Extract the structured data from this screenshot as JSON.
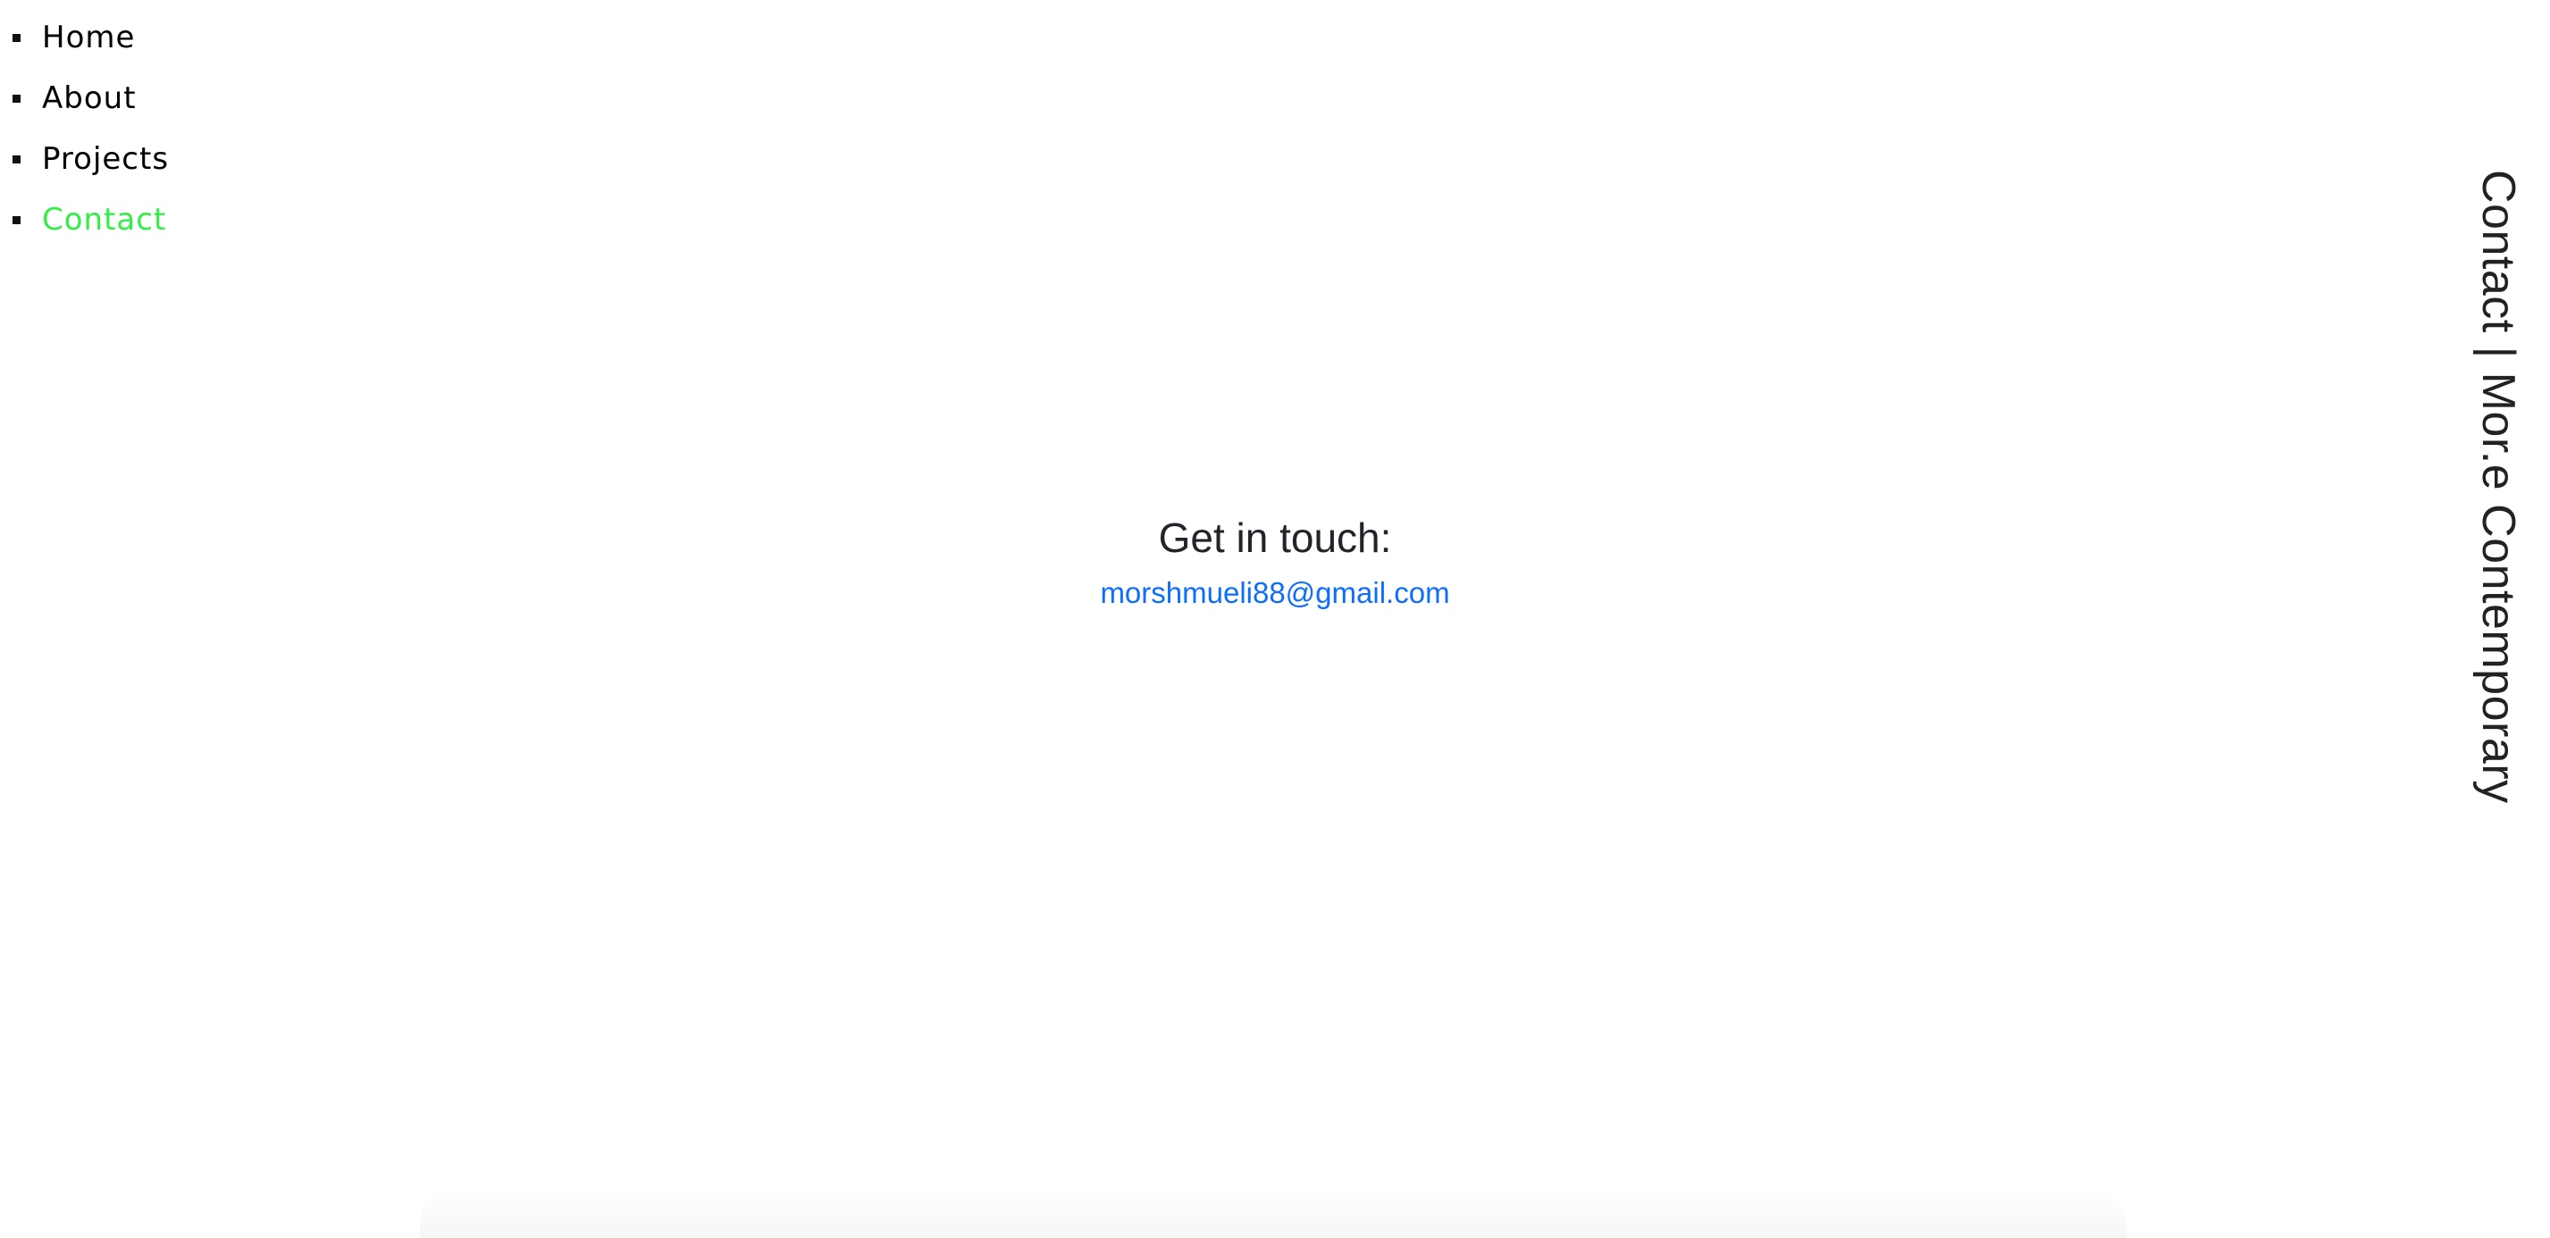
{
  "nav": {
    "items": [
      {
        "label": "Home",
        "active": false
      },
      {
        "label": "About",
        "active": false
      },
      {
        "label": "Projects",
        "active": false
      },
      {
        "label": "Contact",
        "active": true
      }
    ],
    "active_color": "#33ee44"
  },
  "contact": {
    "heading": "Get in touch:",
    "email": "morshmueli88@gmail.com",
    "email_color": "#0d6efd"
  },
  "side_title": "Contact | Mor.e Contemporary"
}
